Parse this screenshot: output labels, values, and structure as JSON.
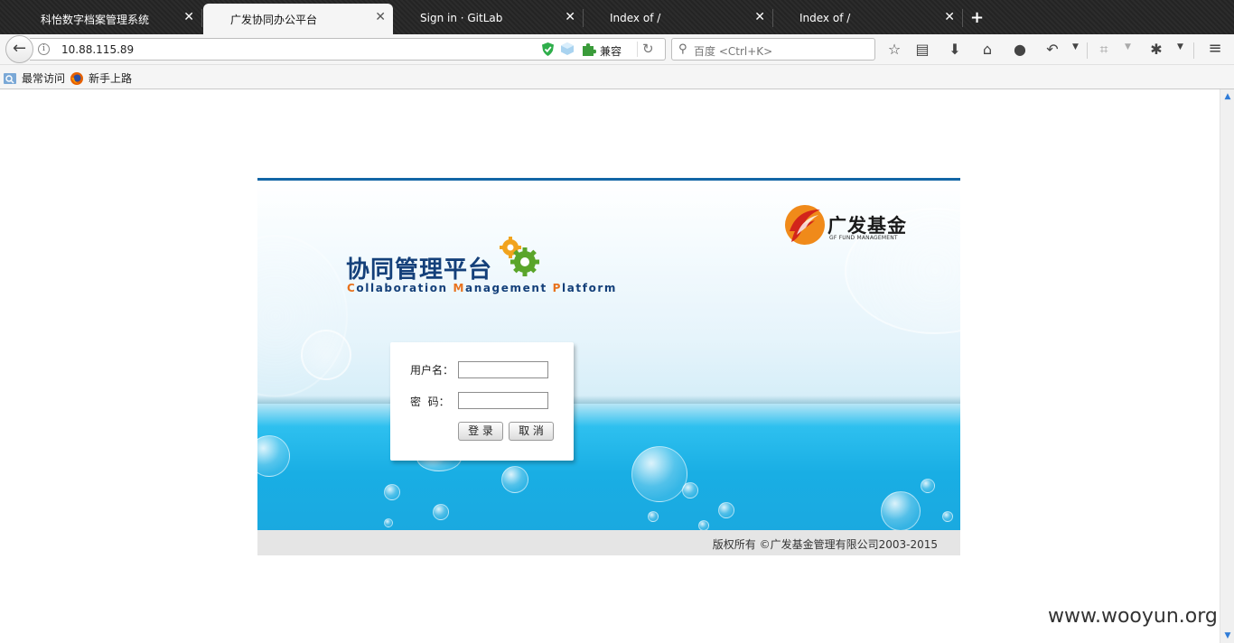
{
  "tabs": [
    {
      "title": "科怡数字档案管理系统",
      "active": false
    },
    {
      "title": "广发协同办公平台",
      "active": true
    },
    {
      "title": "Sign in · GitLab",
      "active": false
    },
    {
      "title": "Index of /",
      "active": false
    },
    {
      "title": "Index of /",
      "active": false
    }
  ],
  "nav": {
    "url": "10.88.115.89",
    "compat_label": "兼容",
    "search_placeholder": "百度 <Ctrl+K>"
  },
  "bookmarks": [
    {
      "label": "最常访问"
    },
    {
      "label": "新手上路"
    }
  ],
  "page": {
    "logo_cn": "协同管理平台",
    "logo_en_parts": [
      "C",
      "ollaboration ",
      "M",
      "anagement ",
      "P",
      "latform"
    ],
    "brand_cn": "广发基金",
    "brand_en": "GF FUND MANAGEMENT",
    "login": {
      "username_label": "用户名：",
      "password_label": "密  码：",
      "login_button": "登 录",
      "cancel_button": "取 消"
    },
    "copyright": "版权所有 ©广发基金管理有限公司2003-2015"
  },
  "watermark": "www.wooyun.org",
  "colors": {
    "accent_blue": "#1266a6",
    "logo_navy": "#14407a",
    "logo_orange": "#e8721e",
    "sea_blue": "#1aa9e0"
  }
}
